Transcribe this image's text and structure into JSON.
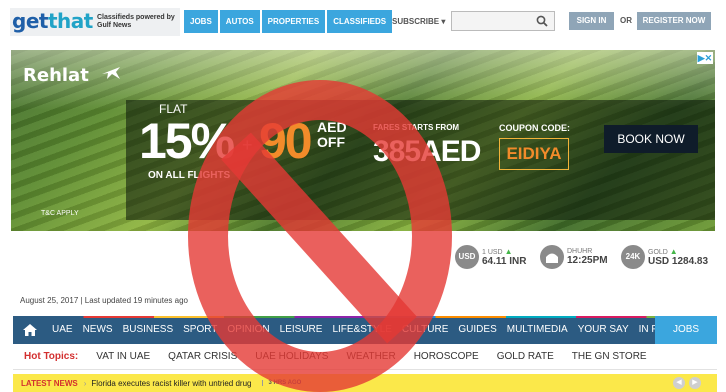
{
  "header": {
    "brand_get": "get",
    "brand_that": "that",
    "tagline": "Classifieds powered by Gulf News",
    "nav": [
      "JOBS",
      "AUTOS",
      "PROPERTIES",
      "CLASSIFIEDS"
    ],
    "subscribe": "SUBSCRIBE",
    "sign_in": "SIGN IN",
    "or": "OR",
    "register": "REGISTER NOW"
  },
  "ad": {
    "brand": "Rehlat",
    "flat": "FLAT",
    "discount": "15%",
    "plus": "+",
    "bonus": "90",
    "bonus_unit": "AED OFF",
    "on_all": "ON  ALL FLIGHTS",
    "fares_label": "FARES STARTS FROM",
    "fare_price": "385AED",
    "coupon_label": "COUPON CODE:",
    "coupon_code": "EIDIYA",
    "cta": "BOOK NOW",
    "corner_text": "T&C APPLY",
    "close_glyph": "▶✕"
  },
  "widgets": {
    "currency": {
      "badge": "USD",
      "small": "1 USD",
      "value": "64.11 INR"
    },
    "prayer": {
      "small": "DHUHR",
      "value": "12:25PM"
    },
    "gold": {
      "badge": "24K",
      "small": "GOLD",
      "value": "USD 1284.83"
    }
  },
  "dateline": "August 25, 2017 | Last updated 19 minutes ago",
  "main_nav": {
    "items": [
      "UAE",
      "NEWS",
      "BUSINESS",
      "SPORT",
      "OPINION",
      "LEISURE",
      "LIFE&STYLE",
      "CULTURE",
      "GUIDES",
      "MULTIMEDIA",
      "YOUR SAY",
      "IN FOCUS"
    ],
    "jobs": "JOBS"
  },
  "hot_topics": {
    "label": "Hot Topics:",
    "items": [
      "VAT IN UAE",
      "QATAR CRISIS",
      "UAE HOLIDAYS",
      "WEATHER",
      "HOROSCOPE",
      "GOLD RATE",
      "THE GN STORE"
    ]
  },
  "latest": {
    "label": "LATEST NEWS",
    "sep": "›",
    "headline": "Florida executes racist killer with untried drug",
    "ago": "3 HRS AGO"
  },
  "colors": {
    "accent_blue": "#3ba6de",
    "nav_blue": "#2c5b82",
    "overlay_red": "#e53935",
    "ticker_yellow": "#fbe84a"
  }
}
